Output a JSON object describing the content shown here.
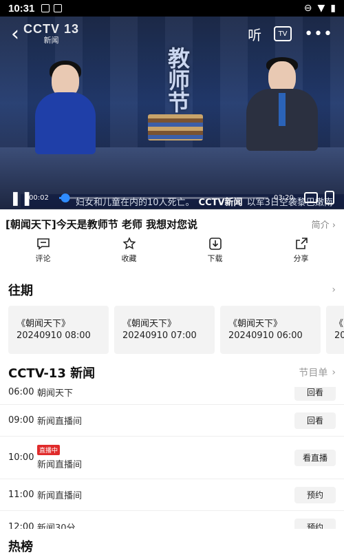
{
  "status_bar": {
    "time": "10:31"
  },
  "player": {
    "channel_logo_text": "CCTV 13",
    "channel_logo_sub": "新闻",
    "listen_label": "听",
    "tv_label": "TV",
    "current_time": "00:02",
    "total_time": "03:20",
    "progress_fraction": 0.03,
    "overlay_title_text": "教师节",
    "ticker_text": "妇女和儿童在内的10人死亡。",
    "ticker_tag": "CCTV新闻",
    "ticker_text2": "以军3日空袭黎巴嫩南"
  },
  "video_title": "[朝闻天下]今天是教师节 老师 我想对您说",
  "intro_label": "简介",
  "actions": [
    {
      "label": "评论",
      "icon": "comment-icon"
    },
    {
      "label": "收藏",
      "icon": "star-icon"
    },
    {
      "label": "下载",
      "icon": "download-icon"
    },
    {
      "label": "分享",
      "icon": "share-icon"
    }
  ],
  "past": {
    "heading": "往期",
    "cards": [
      {
        "show": "《朝闻天下》",
        "date": "20240910 08:00"
      },
      {
        "show": "《朝闻天下》",
        "date": "20240910 07:00"
      },
      {
        "show": "《朝闻天下》",
        "date": "20240910 06:00"
      },
      {
        "show": "《",
        "date": "20"
      }
    ]
  },
  "channel": {
    "heading": "CCTV-13 新闻",
    "schedule_link": "节目单",
    "rows": [
      {
        "time": "06:00",
        "name": "朝闻天下",
        "badge": "",
        "action": "回看"
      },
      {
        "time": "09:00",
        "name": "新闻直播间",
        "badge": "",
        "action": "回看"
      },
      {
        "time": "10:00",
        "name": "新闻直播间",
        "badge": "直播中",
        "action": "看直播"
      },
      {
        "time": "11:00",
        "name": "新闻直播间",
        "badge": "",
        "action": "预约"
      },
      {
        "time": "12:00",
        "name": "新闻30分",
        "badge": "",
        "action": "预约"
      }
    ]
  },
  "hot_heading": "热榜"
}
